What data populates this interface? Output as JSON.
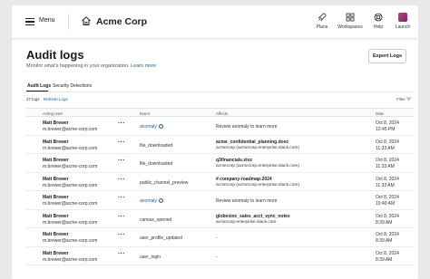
{
  "topbar": {
    "menu_label": "Menu",
    "brand": "Acme Corp",
    "tools": [
      {
        "label": "Plans",
        "icon": "rocket-icon"
      },
      {
        "label": "Workspaces",
        "icon": "grid-icon"
      },
      {
        "label": "Help",
        "icon": "lifebuoy-icon"
      },
      {
        "label": "Launch",
        "icon": "slack-app-icon"
      }
    ]
  },
  "page": {
    "title": "Audit logs",
    "subtitle": "Monitor what's happening in your organization.",
    "learn_more": "Learn more",
    "export_label": "Export Logs"
  },
  "tabs": [
    {
      "label": "Audit Logs",
      "active": true
    },
    {
      "label": "Security Detections",
      "active": false
    }
  ],
  "toolbar": {
    "count": "27 logs",
    "refresh": "Refresh Logs",
    "filter": "Filter"
  },
  "columns": [
    "Acting User",
    "Event",
    "Affects",
    "Date"
  ],
  "rows": [
    {
      "user": "Matt Brewer",
      "email": "m.brewer@acme-corp.com",
      "event": "anomaly",
      "event_link": true,
      "affects_bold": "",
      "affects": "Review anomaly to learn more",
      "date": "Oct 8, 2024",
      "time": "12:45 PM"
    },
    {
      "user": "Matt Brewer",
      "email": "m.brewer@acme-corp.com",
      "event": "file_downloaded",
      "event_link": false,
      "affects_bold": "acme_confidential_planning.doxc",
      "affects": "acmecorp (acmecorp.enterprise.slack.com)",
      "date": "Oct 8, 2024",
      "time": "11:33 AM"
    },
    {
      "user": "Matt Brewer",
      "email": "m.brewer@acme-corp.com",
      "event": "file_downloaded",
      "event_link": false,
      "affects_bold": "q3financials.xlsx",
      "affects": "acmecorp (acmecorp.enterprise.slack.com)",
      "date": "Oct 8, 2024",
      "time": "11:33 AM"
    },
    {
      "user": "Matt Brewer",
      "email": "m.brewer@acme-corp.com",
      "event": "public_channel_preview",
      "event_link": false,
      "affects_bold": "# company-roadmap-2024",
      "affects": "acmecorp (acmecorp.enterprise.slack.com)",
      "date": "Oct 8, 2024",
      "time": "11:33 AM"
    },
    {
      "user": "Matt Brewer",
      "email": "m.brewer@acme-corp.com",
      "event": "anomaly",
      "event_link": true,
      "affects_bold": "",
      "affects": "Review anomaly to learn more",
      "date": "Oct 8, 2024",
      "time": "10:49 AM"
    },
    {
      "user": "Matt Brewer",
      "email": "m.brewer@acme-corp.com",
      "event": "canvas_opened",
      "event_link": false,
      "affects_bold": "globexinc_sales_acct_sync_notes",
      "affects": "acmecorp.enterprise.slack.com",
      "date": "Oct 8, 2024",
      "time": "8:39 AM"
    },
    {
      "user": "Matt Brewer",
      "email": "m.brewer@acme-corp.com",
      "event": "user_profile_updated",
      "event_link": false,
      "affects_bold": "",
      "affects": "-",
      "date": "Oct 8, 2024",
      "time": "8:39 AM"
    },
    {
      "user": "Matt Brewer",
      "email": "m.brewer@acme-corp.com",
      "event": "user_login",
      "event_link": false,
      "affects_bold": "",
      "affects": "-",
      "date": "Oct 8, 2024",
      "time": "8:39 AM"
    }
  ]
}
